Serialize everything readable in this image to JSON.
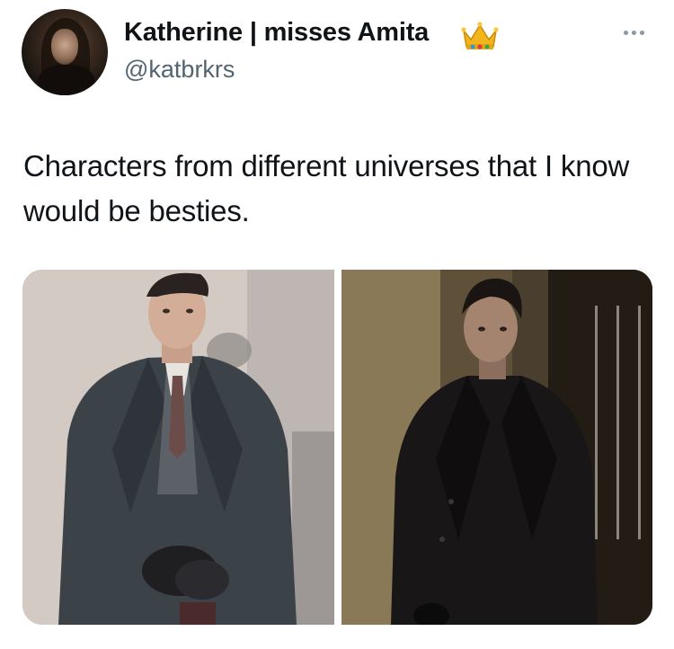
{
  "author": {
    "display_name": "Katherine | misses Amita",
    "badge_icon": "crown-emoji",
    "handle": "@katbrkrs",
    "avatar_icon": "profile-photo"
  },
  "tweet": {
    "text": "Characters from different universes that I know would be besties."
  },
  "media": {
    "photos": [
      {
        "icon": "man-in-dark-overcoat-photo"
      },
      {
        "icon": "man-in-black-coat-photo"
      }
    ]
  },
  "menu": {
    "icon": "more-options-icon"
  },
  "colors": {
    "text_primary": "#0f1419",
    "text_secondary": "#536471",
    "crown_gold": "#f2b51b"
  }
}
